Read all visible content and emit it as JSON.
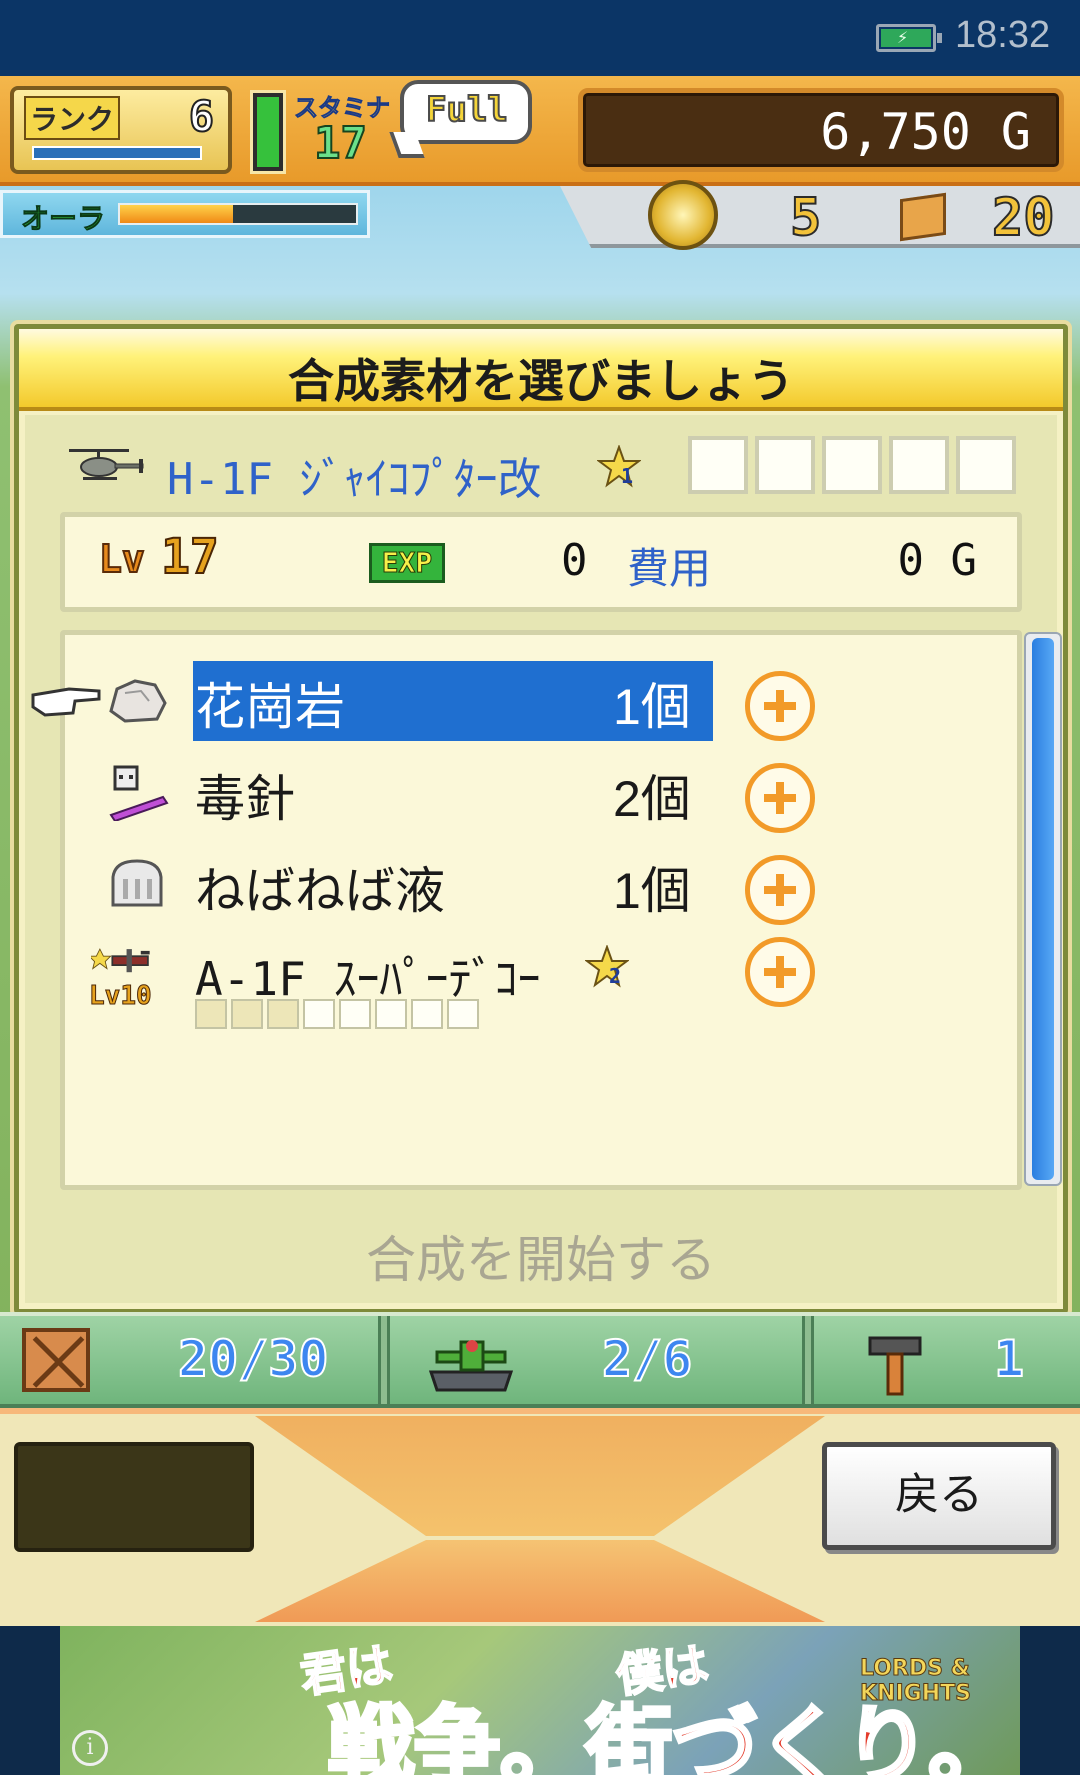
{
  "status_bar": {
    "time": "18:32"
  },
  "hud": {
    "rank_label": "ランク",
    "rank_value": "6",
    "rank_progress": 0.85,
    "stamina_label": "スタミナ",
    "stamina_value": "17",
    "stamina_status": "Full",
    "gold": "6,750 G",
    "aura_label": "オーラ",
    "aura_level": 0.48,
    "medal_count": "5",
    "box_count": "20"
  },
  "dialog": {
    "title": "合成素材を選びましょう",
    "unit_name": "H-1F ｼﾞｬｲｺﾌﾟﾀｰ改",
    "unit_star": "1",
    "stats": {
      "lv_label": "Lv",
      "lv_value": "17",
      "exp_label": "EXP",
      "exp_value": "0",
      "cost_label": "費用",
      "cost_value": "0 G"
    },
    "items": [
      {
        "name": "花崗岩",
        "count": "1個",
        "icon": "rock-icon",
        "selected": true
      },
      {
        "name": "毒針",
        "count": "2個",
        "icon": "poison-needle-icon",
        "selected": false
      },
      {
        "name": "ねばねば液",
        "count": "1個",
        "icon": "slime-icon",
        "selected": false
      },
      {
        "name": "A-1F ｽｰﾊﾟｰﾃﾞｺｰ",
        "star": "2",
        "lv_label": "Lv",
        "lv_value": "10",
        "icon": "biplane-unit-icon",
        "selected": false
      }
    ],
    "start_button": "合成を開始する"
  },
  "bottom_bar": {
    "items_count": "20/30",
    "units_count": "2/6",
    "hammer_count": "1"
  },
  "footer": {
    "back_label": "戻る"
  },
  "ad": {
    "line1": "君は",
    "line2": "戦争。街づくり。",
    "line3": "僕は",
    "logo": "LORDS & KNIGHTS",
    "info": "i"
  },
  "colors": {
    "accent_blue": "#1f6fd0",
    "plus_orange": "#f29a28",
    "dialog_bg": "#f5f1c4",
    "header_yellow": "#f3c92c"
  }
}
